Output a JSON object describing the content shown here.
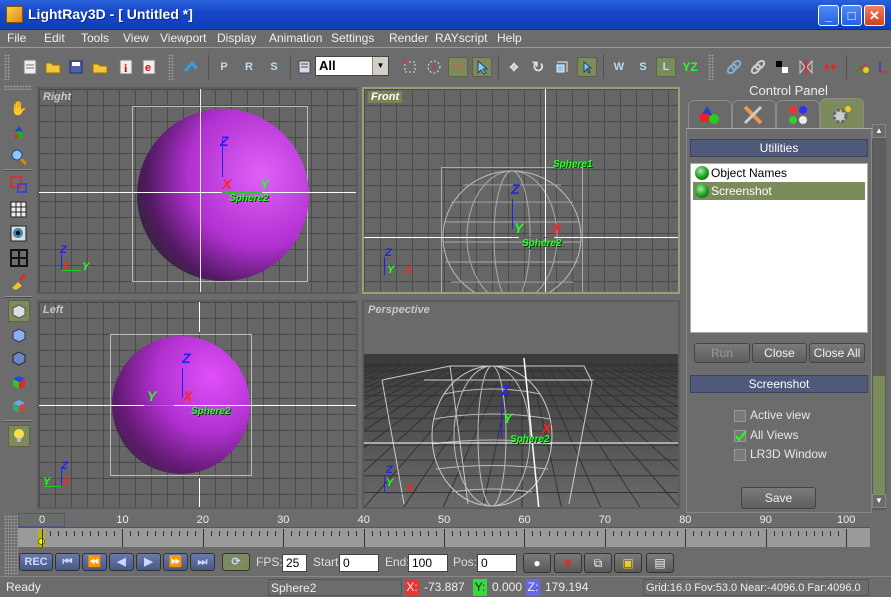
{
  "window": {
    "title": "LightRay3D - [ Untitled *]",
    "minimize": "_",
    "maximize": "□",
    "close": "✕"
  },
  "menu": [
    "File",
    "Edit",
    "Tools",
    "View",
    "Viewport",
    "Display",
    "Animation",
    "Settings",
    "Render",
    "RAYscript",
    "Help"
  ],
  "toolbar": {
    "file_icons": [
      "new-file-icon",
      "open-folder-icon",
      "save-disk-icon",
      "save-as-icon",
      "info-icon",
      "export-icon"
    ],
    "selection_filter": "All",
    "buttons": {
      "p": "P",
      "r": "R",
      "s": "S",
      "wcs": "W",
      "scs": "S",
      "lcs": "L",
      "yz": "YZ"
    }
  },
  "viewports": {
    "right": {
      "label": "Right",
      "object": "Sphere2"
    },
    "front": {
      "label": "Front",
      "objects": [
        "Sphere1",
        "Sphere2"
      ]
    },
    "left": {
      "label": "Left",
      "object": "Sphere2"
    },
    "perspective": {
      "label": "Perspective",
      "object": "Sphere2"
    },
    "axes": {
      "x": "X",
      "y": "Y",
      "z": "Z"
    }
  },
  "control_panel": {
    "title": "Control Panel",
    "tabs": [
      "create-objects",
      "modify-tools",
      "materials",
      "utilities"
    ],
    "utilities_header": "Utilities",
    "utilities": [
      {
        "label": "Object Names",
        "selected": false
      },
      {
        "label": "Screenshot",
        "selected": true
      }
    ],
    "buttons": {
      "run": "Run",
      "close": "Close",
      "close_all": "Close All"
    },
    "screenshot_header": "Screenshot",
    "options": [
      {
        "label": "Active view",
        "checked": false
      },
      {
        "label": "All Views",
        "checked": true
      },
      {
        "label": "LR3D Window",
        "checked": false
      }
    ],
    "save": "Save"
  },
  "timeline": {
    "ticks": [
      "0",
      "10",
      "20",
      "30",
      "40",
      "50",
      "60",
      "70",
      "80",
      "90",
      "100"
    ],
    "current_frame": 0
  },
  "playback": {
    "rec": "REC",
    "fps_label": "FPS:",
    "fps": "25",
    "start_label": "Start:",
    "start": "0",
    "end_label": "End:",
    "end": "100",
    "pos_label": "Pos:",
    "pos": "0"
  },
  "status": {
    "text": "Ready",
    "object": "Sphere2",
    "x_label": "X:",
    "x": "-73.887",
    "y_label": "Y:",
    "y": "0.000",
    "z_label": "Z:",
    "z": "179.194",
    "info": "Grid:16.0 Fov:53.0 Near:-4096.0 Far:4096.0"
  },
  "colors": {
    "accent": "#7d8a5c",
    "header": "#4f5a7a",
    "sphere": "#d040e8",
    "x_axis": "#ff2020",
    "y_axis": "#30ff30",
    "z_axis": "#2020ff"
  }
}
